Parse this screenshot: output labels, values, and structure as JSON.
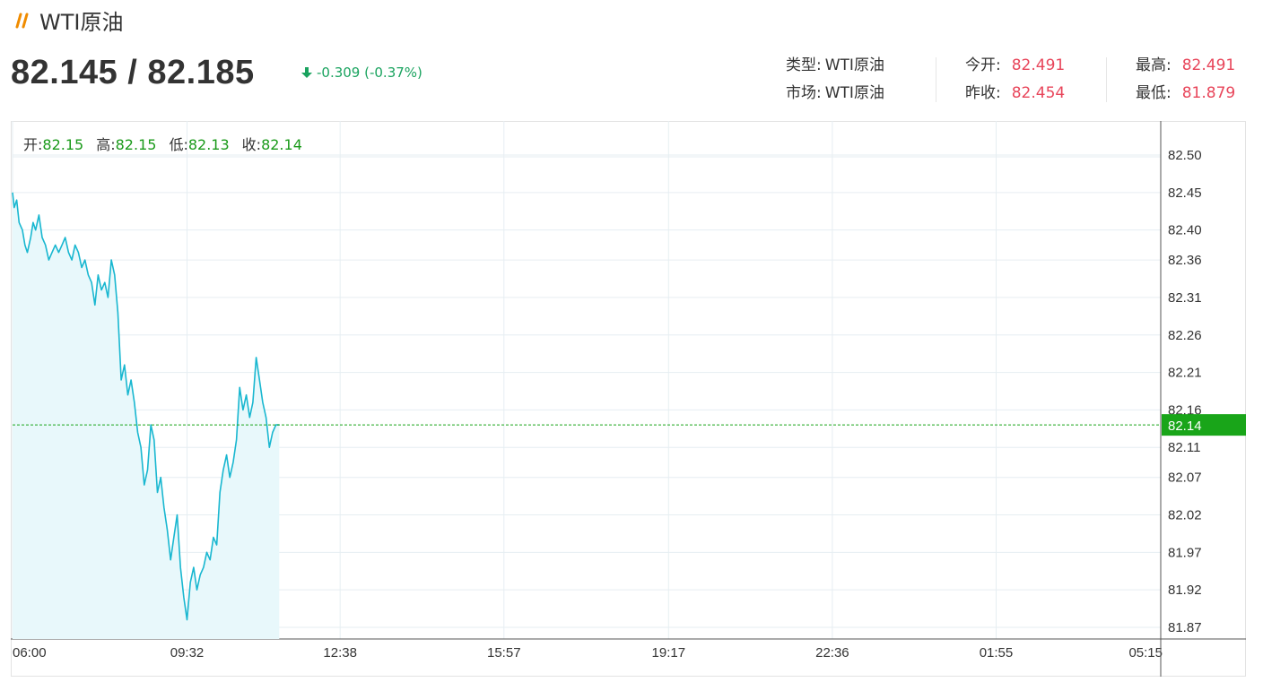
{
  "header": {
    "title": "WTI原油",
    "price": "82.145 / 82.185",
    "change": "-0.309 (-0.37%)"
  },
  "stats": {
    "type_label": "类型:",
    "type_value": "WTI原油",
    "market_label": "市场:",
    "market_value": "WTI原油",
    "open_label": "今开:",
    "open_value": "82.491",
    "prev_close_label": "昨收:",
    "prev_close_value": "82.454",
    "high_label": "最高:",
    "high_value": "82.491",
    "low_label": "最低:",
    "low_value": "81.879"
  },
  "ohlc": {
    "open_label": "开:",
    "open_value": "82.15",
    "high_label": "高:",
    "high_value": "82.15",
    "low_label": "低:",
    "low_value": "82.13",
    "close_label": "收:",
    "close_value": "82.14"
  },
  "colors": {
    "line": "#19b7d0",
    "fill": "#e8f8fb",
    "grid": "#e6eef2",
    "current": "#19a519",
    "up": "#e8455a",
    "down": "#1aa35f",
    "accent": "#f08c00"
  },
  "chart_data": {
    "type": "area",
    "x_ticks": [
      "06:00",
      "09:32",
      "12:38",
      "15:57",
      "19:17",
      "22:36",
      "01:55",
      "05:15"
    ],
    "y_ticks": [
      "82.50",
      "82.45",
      "82.40",
      "82.36",
      "82.31",
      "82.26",
      "82.21",
      "82.16",
      "82.11",
      "82.07",
      "82.02",
      "81.97",
      "81.92",
      "81.87"
    ],
    "ylim": [
      81.87,
      82.5
    ],
    "x_range": [
      "06:00",
      "05:15"
    ],
    "current_value": "82.14",
    "series": [
      {
        "x": [
          "06:00",
          "06:02",
          "06:05",
          "06:08",
          "06:12",
          "06:15",
          "06:18",
          "06:22",
          "06:25",
          "06:28",
          "06:32",
          "06:36",
          "06:40",
          "06:44",
          "06:48",
          "06:52",
          "06:56",
          "07:00",
          "07:04",
          "07:08",
          "07:12",
          "07:16",
          "07:20",
          "07:24",
          "07:28",
          "07:32",
          "07:36",
          "07:40",
          "07:44",
          "07:48",
          "07:52",
          "07:56",
          "08:00",
          "08:04",
          "08:08",
          "08:12",
          "08:16",
          "08:20",
          "08:24",
          "08:28",
          "08:32",
          "08:36",
          "08:40",
          "08:44",
          "08:48",
          "08:52",
          "08:56",
          "09:00",
          "09:04",
          "09:08",
          "09:12",
          "09:16",
          "09:20",
          "09:24",
          "09:28",
          "09:32",
          "09:36",
          "09:40",
          "09:44",
          "09:48",
          "09:52",
          "09:56",
          "10:00",
          "10:04",
          "10:08",
          "10:12",
          "10:16",
          "10:20",
          "10:24",
          "10:28",
          "10:32",
          "10:36",
          "10:40",
          "10:44",
          "10:48",
          "10:52",
          "10:56",
          "11:00",
          "11:04",
          "11:08",
          "11:12",
          "11:16",
          "11:20",
          "11:24"
        ],
        "values": [
          82.45,
          82.43,
          82.44,
          82.41,
          82.4,
          82.38,
          82.37,
          82.39,
          82.41,
          82.4,
          82.42,
          82.39,
          82.38,
          82.36,
          82.37,
          82.38,
          82.37,
          82.38,
          82.39,
          82.37,
          82.36,
          82.38,
          82.37,
          82.35,
          82.36,
          82.34,
          82.33,
          82.3,
          82.34,
          82.32,
          82.33,
          82.31,
          82.36,
          82.34,
          82.29,
          82.2,
          82.22,
          82.18,
          82.2,
          82.17,
          82.13,
          82.11,
          82.06,
          82.08,
          82.14,
          82.12,
          82.05,
          82.07,
          82.03,
          82.0,
          81.96,
          81.99,
          82.02,
          81.95,
          81.91,
          81.88,
          81.93,
          81.95,
          81.92,
          81.94,
          81.95,
          81.97,
          81.96,
          81.99,
          81.98,
          82.05,
          82.08,
          82.1,
          82.07,
          82.09,
          82.12,
          82.19,
          82.16,
          82.18,
          82.15,
          82.17,
          82.23,
          82.2,
          82.17,
          82.15,
          82.11,
          82.13,
          82.14,
          82.14
        ]
      }
    ]
  }
}
